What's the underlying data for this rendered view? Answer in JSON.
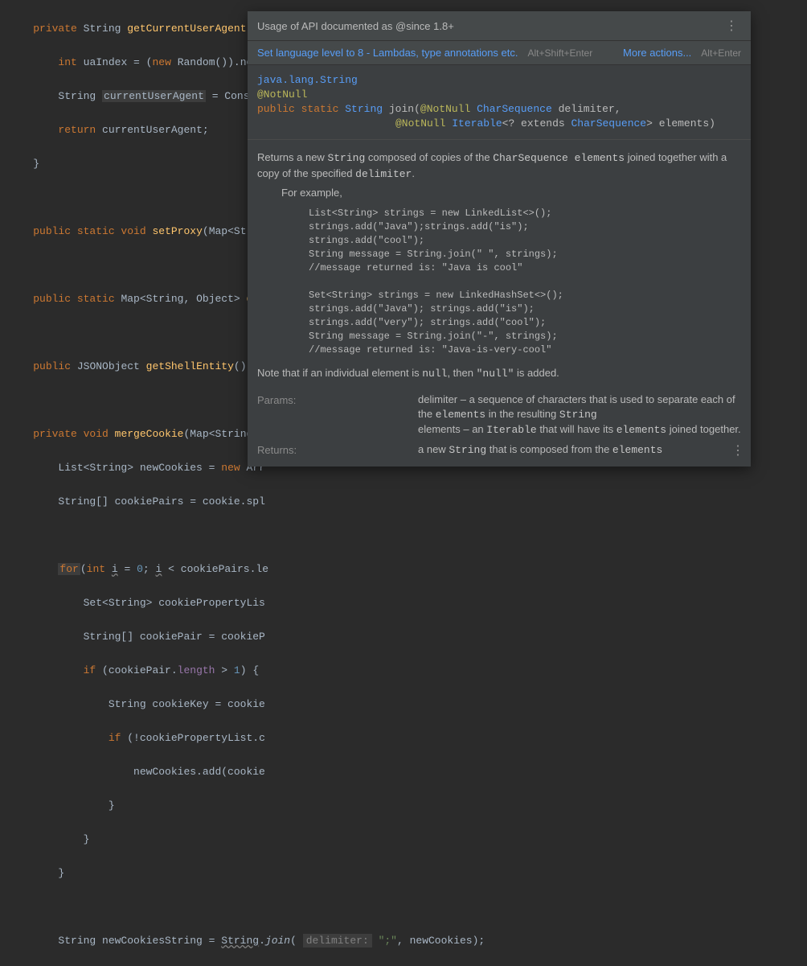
{
  "code": {
    "l1a": "private",
    "l1b": "String",
    "l1c": "getCurrentUserAgent",
    "l1d": "() {",
    "l2a": "int",
    "l2b": "uaIndex = (",
    "l2c": "new",
    "l2d": "Random()).next",
    "l3a": "String",
    "l3b": "currentUserAgent",
    "l3c": "= Constan",
    "l4a": "return",
    "l4b": "currentUserAgent;",
    "l5": "}",
    "l7a": "public static void",
    "l7b": "setProxy",
    "l7c": "(Map<Strin",
    "l9a": "public static",
    "l9b": "Map<String, Object>",
    "l9c": "get",
    "l11a": "public",
    "l11b": "JSONObject",
    "l11c": "getShellEntity",
    "l11d": "() {",
    "l13a": "private void",
    "l13b": "mergeCookie",
    "l13c": "(Map<String,",
    "l14a": "List<String> newCookies =",
    "l14b": "new",
    "l14c": "Arr",
    "l15a": "String[] cookiePairs = cookie.spl",
    "l17a": "for",
    "l17b": "(",
    "l17c": "int",
    "l17d": "i",
    "l17e": "=",
    "l17f": "0",
    "l17g": ";",
    "l17h": "i",
    "l17i": "< cookiePairs.le",
    "l18a": "Set<String> cookiePropertyLis",
    "l19a": "String[] cookiePair = cookieP",
    "l20a": "if",
    "l20b": "(cookiePair.",
    "l20c": "length",
    "l20d": ">",
    "l20e": "1",
    "l20f": ") {",
    "l21a": "String cookieKey = cookie",
    "l22a": "if",
    "l22b": "(!cookiePropertyList.c",
    "l23a": "newCookies.add(cookie",
    "l24": "}",
    "l25": "}",
    "l26": "}",
    "l28a": "String newCookiesString =",
    "l28b": "String",
    "l28c": ".",
    "l28d": "join",
    "l28e": "(",
    "l28hint": "delimiter:",
    "l28f": "\";\"",
    "l28g": ", newCookies);"
  },
  "popup": {
    "title": "Usage of API documented as @since 1.8+",
    "action1": "Set language level to 8 - Lambdas, type annotations etc.",
    "shortcut1": "Alt+Shift+Enter",
    "action2": "More actions...",
    "shortcut2": "Alt+Enter",
    "sig_pkg": "java.lang.String",
    "sig_anno": "@NotNull",
    "sig_mods": "public static",
    "sig_ret": "String",
    "sig_name": "join",
    "sig_p1a": "@NotNull",
    "sig_p1t": "CharSequence",
    "sig_p1n": "delimiter,",
    "sig_p2a": "@NotNull",
    "sig_p2t": "Iterable",
    "sig_p2g": "<? extends ",
    "sig_p2t2": "CharSequence",
    "sig_p2n": "> elements)",
    "desc1a": "Returns a new ",
    "desc1b": "String",
    "desc1c": " composed of copies of the ",
    "desc1d": "CharSequence",
    "desc1e": "  elements",
    "desc1f": " joined together with a copy of the specified ",
    "desc1g": "delimiter",
    "desc1h": ".",
    "example_label": "For example,",
    "code1": "List<String> strings = new LinkedList<>();\nstrings.add(\"Java\");strings.add(\"is\");\nstrings.add(\"cool\");\nString message = String.join(\" \", strings);\n//message returned is: \"Java is cool\"\n\nSet<String> strings = new LinkedHashSet<>();\nstrings.add(\"Java\"); strings.add(\"is\");\nstrings.add(\"very\"); strings.add(\"cool\");\nString message = String.join(\"-\", strings);\n//message returned is: \"Java-is-very-cool\"",
    "note1a": "Note that if an individual element is ",
    "note1b": "null",
    "note1c": ", then ",
    "note1d": "\"null\"",
    "note1e": " is added.",
    "params_label": "Params:",
    "param1a": "delimiter – a sequence of characters that is used to separate each of the ",
    "param1b": "elements",
    "param1c": " in the resulting ",
    "param1d": "String",
    "param2a": "elements – an ",
    "param2b": "Iterable",
    "param2c": " that will have its ",
    "param2d": "elements",
    "param2e": " joined together.",
    "returns_label": "Returns:",
    "returns1a": "a new ",
    "returns1b": "String",
    "returns1c": " that is composed from the ",
    "returns1d": "elements"
  }
}
